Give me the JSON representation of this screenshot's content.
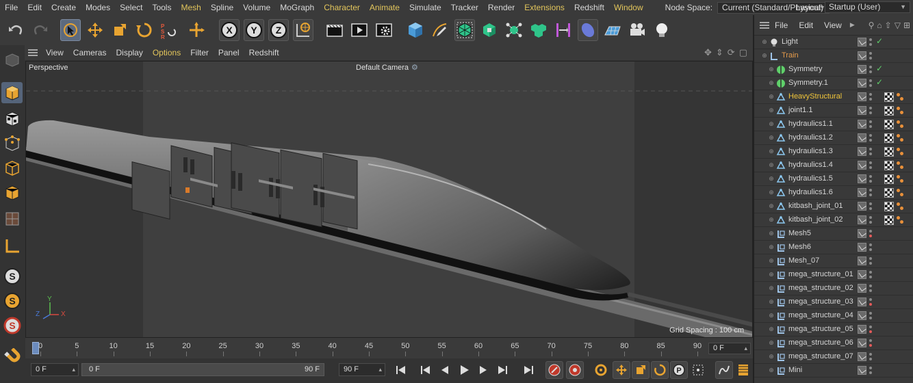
{
  "menubar": {
    "items": [
      "File",
      "Edit",
      "Create",
      "Modes",
      "Select",
      "Tools",
      "Mesh",
      "Spline",
      "Volume",
      "MoGraph",
      "Character",
      "Animate",
      "Simulate",
      "Tracker",
      "Render",
      "Extensions",
      "Redshift",
      "Window"
    ],
    "highlighted": [
      "Mesh",
      "Character",
      "Animate",
      "Extensions",
      "Window"
    ],
    "node_space_label": "Node Space:",
    "node_space_value": "Current (Standard/Physical)",
    "layout_label": "Layout:",
    "layout_value": "Startup (User)"
  },
  "toolbar": {
    "tools": [
      "undo-icon",
      "redo-icon",
      "select-arrow-icon",
      "move-icon",
      "scale-icon",
      "rotate-icon",
      "psr-reset-icon",
      "world-axis-icon",
      "x-axis-lock-icon",
      "y-axis-lock-icon",
      "z-axis-lock-icon",
      "coordinate-system-icon",
      "render-region-icon",
      "render-view-icon",
      "render-settings-icon",
      "cube-primitive-icon",
      "pen-spline-icon",
      "subdivision-icon",
      "generator-icon",
      "mograph-cloner-icon",
      "field-icon",
      "deformer-icon",
      "effector-icon",
      "floor-icon",
      "camera-icon",
      "light-icon"
    ]
  },
  "viewport_menu": {
    "items": [
      "View",
      "Cameras",
      "Display",
      "Options",
      "Filter",
      "Panel",
      "Redshift"
    ],
    "highlighted": [
      "Options"
    ]
  },
  "viewport": {
    "view_name": "Perspective",
    "camera_name": "Default Camera",
    "grid_spacing": "Grid Spacing : 100 cm",
    "axis_labels": [
      "Y",
      "Z",
      "X"
    ],
    "colors": {
      "x_axis": "#d94a3f",
      "y_axis": "#5bbf4f",
      "z_axis": "#4a7ad9"
    }
  },
  "timeline": {
    "ticks": [
      "0",
      "5",
      "10",
      "15",
      "20",
      "25",
      "30",
      "35",
      "40",
      "45",
      "50",
      "55",
      "60",
      "65",
      "70",
      "75",
      "80",
      "85",
      "90"
    ],
    "current_frame_display": "0 F"
  },
  "transport": {
    "start_field": "0 F",
    "range_start": "0 F",
    "range_end": "90 F",
    "end_field": "90 F"
  },
  "object_manager": {
    "menu": [
      "File",
      "Edit",
      "View"
    ],
    "objects": [
      {
        "name": "Light",
        "indent": 0,
        "type": "light",
        "color": "normal",
        "vis": true,
        "check": true,
        "tags": false,
        "red_dot": false
      },
      {
        "name": "Train",
        "indent": 0,
        "type": "null",
        "color": "orange",
        "vis": true,
        "check": false,
        "tags": false,
        "red_dot": false
      },
      {
        "name": "Symmetry",
        "indent": 1,
        "type": "symmetry",
        "color": "normal",
        "vis": true,
        "check": true,
        "tags": false,
        "red_dot": false
      },
      {
        "name": "Symmetry.1",
        "indent": 1,
        "type": "symmetry",
        "color": "normal",
        "vis": true,
        "check": true,
        "tags": false,
        "red_dot": false
      },
      {
        "name": "HeavyStructural",
        "indent": 1,
        "type": "joint",
        "color": "yellow",
        "vis": true,
        "check": false,
        "tags": true,
        "red_dot": false
      },
      {
        "name": "joint1.1",
        "indent": 1,
        "type": "joint",
        "color": "normal",
        "vis": true,
        "check": false,
        "tags": true,
        "red_dot": false
      },
      {
        "name": "hydraulics1.1",
        "indent": 1,
        "type": "joint",
        "color": "normal",
        "vis": true,
        "check": false,
        "tags": true,
        "red_dot": false
      },
      {
        "name": "hydraulics1.2",
        "indent": 1,
        "type": "joint",
        "color": "normal",
        "vis": true,
        "check": false,
        "tags": true,
        "red_dot": false
      },
      {
        "name": "hydraulics1.3",
        "indent": 1,
        "type": "joint",
        "color": "normal",
        "vis": true,
        "check": false,
        "tags": true,
        "red_dot": false
      },
      {
        "name": "hydraulics1.4",
        "indent": 1,
        "type": "joint",
        "color": "normal",
        "vis": true,
        "check": false,
        "tags": true,
        "red_dot": false
      },
      {
        "name": "hydraulics1.5",
        "indent": 1,
        "type": "joint",
        "color": "normal",
        "vis": true,
        "check": false,
        "tags": true,
        "red_dot": false
      },
      {
        "name": "hydraulics1.6",
        "indent": 1,
        "type": "joint",
        "color": "normal",
        "vis": true,
        "check": false,
        "tags": true,
        "red_dot": false
      },
      {
        "name": "kitbash_joint_01",
        "indent": 1,
        "type": "joint",
        "color": "normal",
        "vis": true,
        "check": false,
        "tags": true,
        "red_dot": false
      },
      {
        "name": "kitbash_joint_02",
        "indent": 1,
        "type": "joint",
        "color": "normal",
        "vis": true,
        "check": false,
        "tags": true,
        "red_dot": false
      },
      {
        "name": "Mesh5",
        "indent": 1,
        "type": "mesh",
        "color": "normal",
        "vis": true,
        "check": false,
        "tags": false,
        "red_dot": true
      },
      {
        "name": "Mesh6",
        "indent": 1,
        "type": "mesh",
        "color": "normal",
        "vis": true,
        "check": false,
        "tags": false,
        "red_dot": false
      },
      {
        "name": "Mesh_07",
        "indent": 1,
        "type": "mesh",
        "color": "normal",
        "vis": true,
        "check": false,
        "tags": false,
        "red_dot": false
      },
      {
        "name": "mega_structure_01",
        "indent": 1,
        "type": "mesh",
        "color": "normal",
        "vis": true,
        "check": false,
        "tags": false,
        "red_dot": false
      },
      {
        "name": "mega_structure_02",
        "indent": 1,
        "type": "mesh",
        "color": "normal",
        "vis": true,
        "check": false,
        "tags": false,
        "red_dot": false
      },
      {
        "name": "mega_structure_03",
        "indent": 1,
        "type": "mesh",
        "color": "normal",
        "vis": true,
        "check": false,
        "tags": false,
        "red_dot": true
      },
      {
        "name": "mega_structure_04",
        "indent": 1,
        "type": "mesh",
        "color": "normal",
        "vis": true,
        "check": false,
        "tags": false,
        "red_dot": false
      },
      {
        "name": "mega_structure_05",
        "indent": 1,
        "type": "mesh",
        "color": "normal",
        "vis": true,
        "check": false,
        "tags": false,
        "red_dot": true
      },
      {
        "name": "mega_structure_06",
        "indent": 1,
        "type": "mesh",
        "color": "normal",
        "vis": true,
        "check": false,
        "tags": false,
        "red_dot": true
      },
      {
        "name": "mega_structure_07",
        "indent": 1,
        "type": "mesh",
        "color": "normal",
        "vis": true,
        "check": false,
        "tags": false,
        "red_dot": false
      },
      {
        "name": "Mini",
        "indent": 1,
        "type": "mesh",
        "color": "normal",
        "vis": true,
        "check": false,
        "tags": false,
        "red_dot": false
      }
    ]
  }
}
